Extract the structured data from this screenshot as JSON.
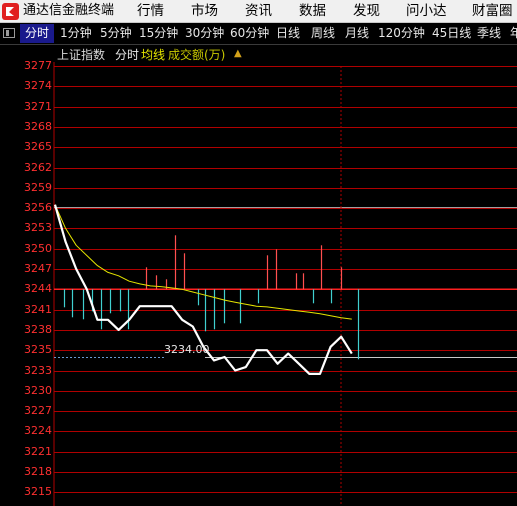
{
  "app": {
    "title": "通达信金融终端",
    "logo_color": "#e02020"
  },
  "menu": [
    "行情",
    "市场",
    "资讯",
    "数据",
    "发现",
    "问小达",
    "财富圈"
  ],
  "periods": [
    "分时",
    "1分钟",
    "5分钟",
    "15分钟",
    "30分钟",
    "60分钟",
    "日线",
    "周线",
    "月线",
    "120分钟",
    "45日线",
    "季线",
    "年"
  ],
  "active_period": "分时",
  "info": {
    "index_name": "上证指数",
    "mode": "分时",
    "avg_label": "均线",
    "volume_label": "成交额(万)"
  },
  "colors": {
    "up": "#ff3030",
    "down": "#3cc83c",
    "grid": "#b00000",
    "price_line": "#ffffff",
    "avg_line": "#e5e500",
    "volume_up": "#ff5050",
    "volume_down": "#40d0d0"
  },
  "reference_price_label": "3234.00",
  "chart_data": {
    "type": "line",
    "prev_close": 3244,
    "ylim": [
      3214,
      3278
    ],
    "y_ticks": [
      "3277",
      "3274",
      "3271",
      "3268",
      "3265",
      "3262",
      "3259",
      "3256",
      "3253",
      "3250",
      "3247",
      "3244",
      "3241",
      "3238",
      "3235",
      "3233",
      "3230",
      "3227",
      "3224",
      "3221",
      "3218",
      "3215"
    ],
    "series": [
      {
        "values": [
          3256.5,
          3251,
          3247,
          3244,
          3239.5,
          3239.5,
          3238,
          3239.5,
          3241.5,
          3241.5,
          3241.5,
          3241.5,
          3239.5,
          3238.5,
          3235.5,
          3233.5,
          3234,
          3232,
          3232.5,
          3235,
          3235,
          3233,
          3234.5,
          3233,
          3231.5,
          3231.5,
          3235.5,
          3237,
          3234.5
        ]
      },
      {
        "values": [
          3256.5,
          3253,
          3250.5,
          3249,
          3247.5,
          3246.5,
          3246,
          3245.2,
          3244.8,
          3244.5,
          3244.4,
          3244.2,
          3244.0,
          3243.6,
          3243.2,
          3242.8,
          3242.4,
          3242.1,
          3241.8,
          3241.5,
          3241.4,
          3241.2,
          3241.0,
          3240.8,
          3240.6,
          3240.4,
          3240.1,
          3239.8,
          3239.6
        ]
      }
    ]
  }
}
